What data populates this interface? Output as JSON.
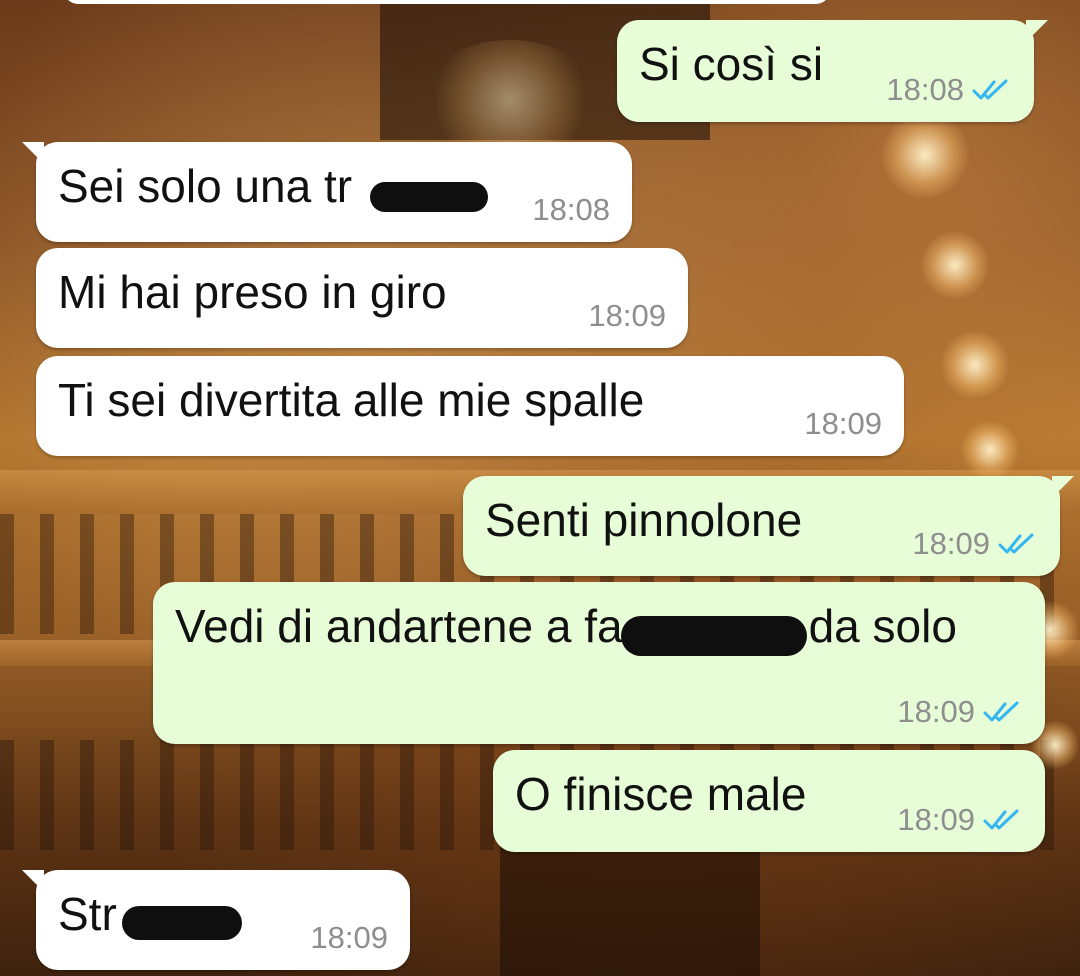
{
  "messages": [
    {
      "direction": "out",
      "text": "Si così si",
      "time": "18:08",
      "status": "read"
    },
    {
      "direction": "in",
      "text": "Sei solo una tr",
      "time": "18:08",
      "redacted": true
    },
    {
      "direction": "in",
      "text": "Mi hai preso in giro",
      "time": "18:09"
    },
    {
      "direction": "in",
      "text": "Ti sei divertita alle mie spalle",
      "time": "18:09"
    },
    {
      "direction": "out",
      "text": "Senti pinnolone",
      "time": "18:09",
      "status": "read"
    },
    {
      "direction": "out",
      "text_before": "Vedi di andartene a fa",
      "text_after": "da solo",
      "time": "18:09",
      "status": "read",
      "redacted": true
    },
    {
      "direction": "out",
      "text": "O finisce male",
      "time": "18:09",
      "status": "read"
    },
    {
      "direction": "in",
      "text": "Str",
      "time": "18:09",
      "redacted": true
    }
  ],
  "colors": {
    "incoming_bubble": "#ffffff",
    "outgoing_bubble": "#e7fdd8",
    "read_tick": "#34b7f1",
    "timestamp": "#8e8e8e"
  },
  "icons": {
    "read_receipt": "double-check-icon"
  }
}
